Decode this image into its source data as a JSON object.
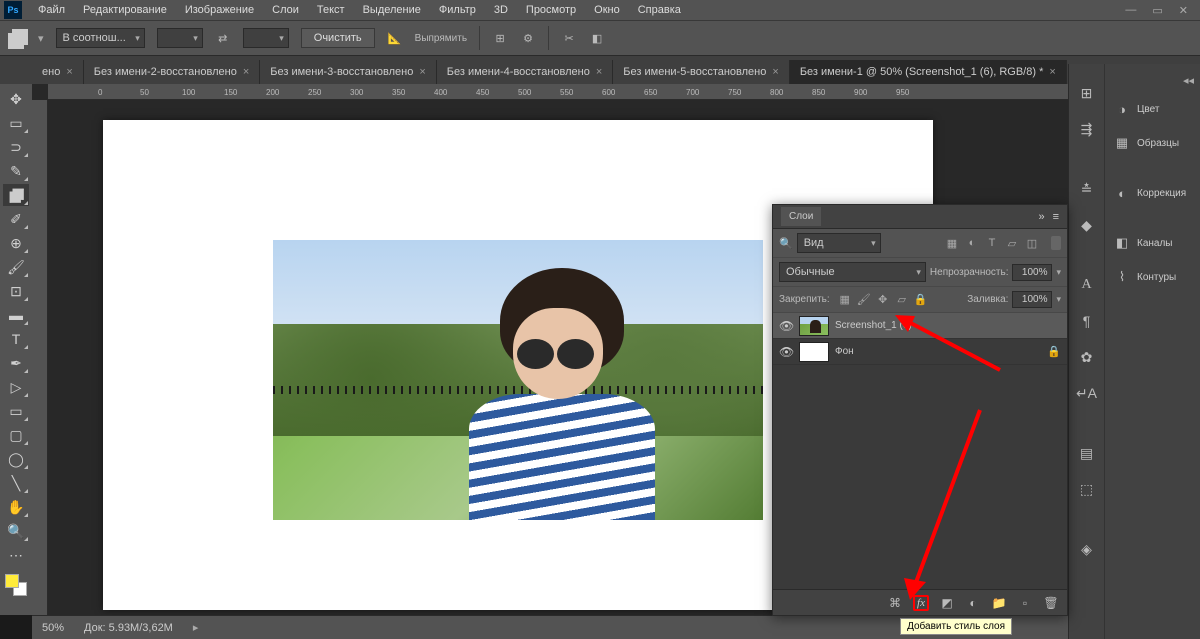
{
  "menu": {
    "items": [
      "Файл",
      "Редактирование",
      "Изображение",
      "Слои",
      "Текст",
      "Выделение",
      "Фильтр",
      "3D",
      "Просмотр",
      "Окно",
      "Справка"
    ]
  },
  "options": {
    "ratio": "В соотнош...",
    "clear": "Очистить",
    "straighten": "Выпрямить"
  },
  "tabs": {
    "items": [
      {
        "label": "ено",
        "active": false
      },
      {
        "label": "Без имени-2-восстановлено",
        "active": false
      },
      {
        "label": "Без имени-3-восстановлено",
        "active": false
      },
      {
        "label": "Без имени-4-восстановлено",
        "active": false
      },
      {
        "label": "Без имени-5-восстановлено",
        "active": false
      },
      {
        "label": "Без имени-1 @ 50% (Screenshot_1 (6), RGB/8) *",
        "active": true
      }
    ]
  },
  "ruler": {
    "marks": [
      "0",
      "50",
      "100",
      "150",
      "200",
      "250",
      "300",
      "350",
      "400",
      "450",
      "500",
      "550",
      "600",
      "650",
      "700",
      "750",
      "800",
      "850",
      "900",
      "950"
    ]
  },
  "layers_panel": {
    "title": "Слои",
    "kind": "Вид",
    "blend": "Обычные",
    "opacity_label": "Непрозрачность:",
    "opacity": "100%",
    "lock_label": "Закрепить:",
    "fill_label": "Заливка:",
    "fill": "100%",
    "layers": [
      {
        "name": "Screenshot_1 (6)",
        "locked": false,
        "selected": true,
        "type": "photo"
      },
      {
        "name": "Фон",
        "locked": true,
        "selected": false,
        "type": "white"
      }
    ],
    "tooltip": "Добавить стиль слоя"
  },
  "dock": {
    "panels": [
      "Цвет",
      "Образцы",
      "Коррекция",
      "Каналы",
      "Контуры"
    ]
  },
  "status": {
    "zoom": "50%",
    "doc": "Док: 5.93M/3,62M"
  }
}
